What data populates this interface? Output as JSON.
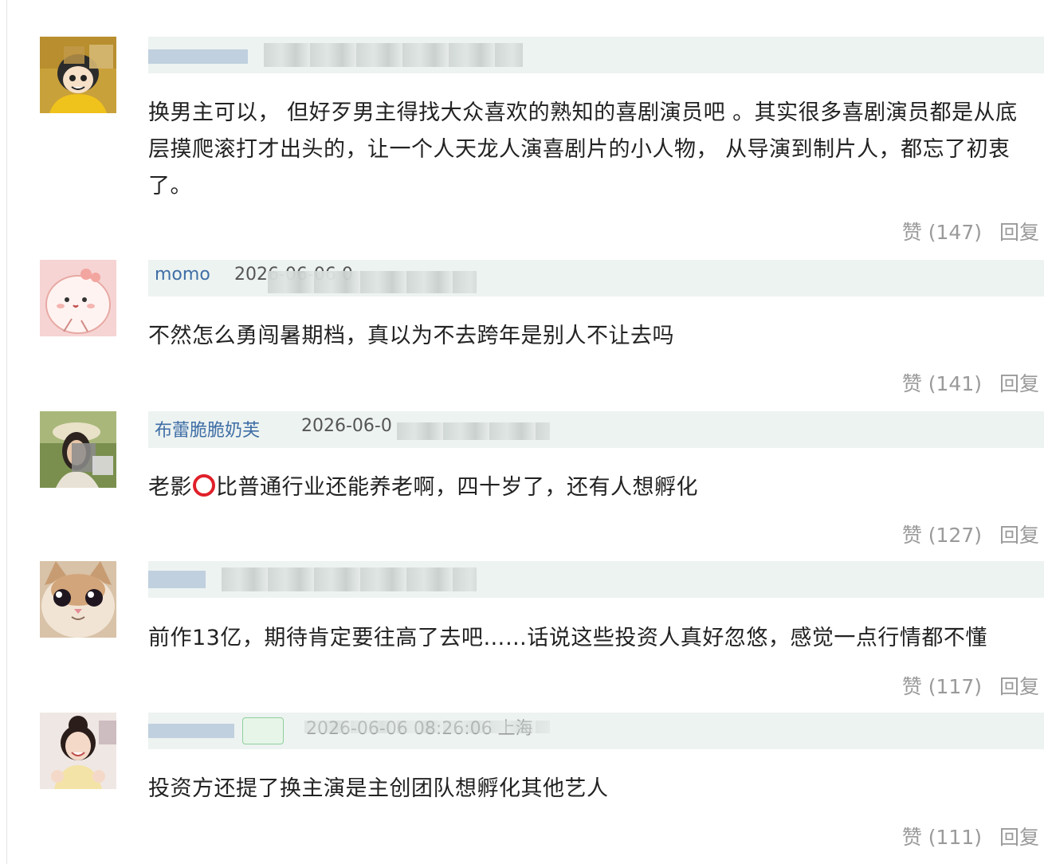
{
  "comments": [
    {
      "username": "",
      "datetime": "",
      "text": "换男主可以， 但好歹男主得找大众喜欢的熟知的喜剧演员吧 。其实很多喜剧演员都是从底层摸爬滚打才出头的，让一个人天龙人演喜剧片的小人物， 从导演到制片人，都忘了初衷了。",
      "likes": "赞 (147)",
      "reply": "回复"
    },
    {
      "username": "momo",
      "datetime": "2026-06-06 0",
      "text": "不然怎么勇闯暑期档，真以为不去跨年是别人不让去吗",
      "likes": "赞 (141)",
      "reply": "回复"
    },
    {
      "username": "布蕾脆脆奶芙",
      "datetime": "2026-06-0",
      "text_before": "老影",
      "text_after": "比普通行业还能养老啊，四十岁了，还有人想孵化",
      "likes": "赞 (127)",
      "reply": "回复"
    },
    {
      "username": "",
      "datetime": "",
      "text": "前作13亿，期待肯定要往高了去吧……话说这些投资人真好忽悠，感觉一点行情都不懂",
      "likes": "赞 (117)",
      "reply": "回复"
    },
    {
      "username": "",
      "datetime": "2026-06-06 08:26:06 上海",
      "text": "投资方还提了换主演是主创团队想孵化其他艺人",
      "likes": "赞 (111)",
      "reply": "回复"
    }
  ],
  "colors": {
    "header_bg": "#edf3f1",
    "username": "#3f6ea6",
    "action_text": "#9a9a9a",
    "circle_mark": "#e0202a"
  },
  "icons": {
    "avatar_1": "cartoon-girl-avatar",
    "avatar_2": "pink-blob-avatar",
    "avatar_3": "photo-avatar",
    "avatar_4": "cat-avatar",
    "avatar_5": "photo-avatar",
    "inline_mark": "red-circle-icon"
  }
}
